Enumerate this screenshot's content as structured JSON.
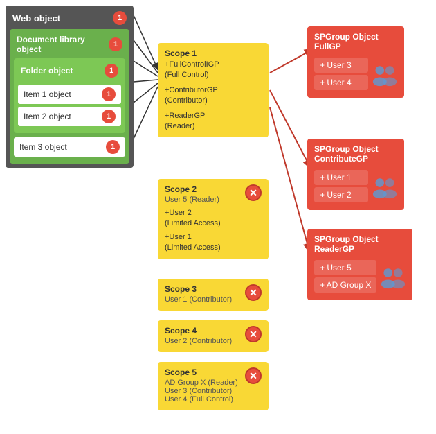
{
  "webObject": {
    "title": "Web object",
    "badge": "1",
    "docLibrary": {
      "title": "Document library object",
      "badge": "1",
      "folder": {
        "title": "Folder object",
        "badge": "1",
        "items": [
          {
            "label": "Item 1 object",
            "badge": "1"
          },
          {
            "label": "Item 2 object",
            "badge": "1"
          },
          {
            "label": "Item 3 object",
            "badge": "1"
          }
        ]
      }
    }
  },
  "scopes": [
    {
      "id": "scope1",
      "title": "Scope 1",
      "entries": [
        "+FullControlIGP\n(Full Control)",
        "+ContributorGP\n(Contributor)",
        "+ReaderGP\n(Reader)"
      ],
      "hasX": false
    },
    {
      "id": "scope2",
      "title": "Scope 2",
      "subtitle": "User 5 (Reader)",
      "entries": [
        "+User 2\n(Limited Access)",
        "+User 1\n(Limited Access)"
      ],
      "hasX": true
    },
    {
      "id": "scope3",
      "title": "Scope 3",
      "subtitle": "User 1 (Contributor)",
      "entries": [],
      "hasX": true
    },
    {
      "id": "scope4",
      "title": "Scope 4",
      "subtitle": "User 2 (Contributor)",
      "entries": [],
      "hasX": true
    },
    {
      "id": "scope5",
      "title": "Scope 5",
      "subtitle": "AD Group X (Reader)\nUser 3 (Contributor)\nUser 4 (Full Control)",
      "entries": [],
      "hasX": true
    }
  ],
  "spgroups": [
    {
      "id": "spgroup1",
      "title": "SPGroup Object\nFullGP",
      "users": [
        "+ User 3",
        "+ User 4"
      ]
    },
    {
      "id": "spgroup2",
      "title": "SPGroup Object\nContributeGP",
      "users": [
        "+ User 1",
        "+ User 2"
      ]
    },
    {
      "id": "spgroup3",
      "title": "SPGroup Object\nReaderGP",
      "users": [
        "+ User 5",
        "+ AD Group X"
      ]
    }
  ],
  "colors": {
    "badge": "#e74c3c",
    "scopeBg": "#f9d835",
    "spgroupBg": "#e74c3c",
    "webPanelBg": "#555555",
    "docLibBg": "#6ab04c",
    "folderBg": "#7dc855"
  }
}
